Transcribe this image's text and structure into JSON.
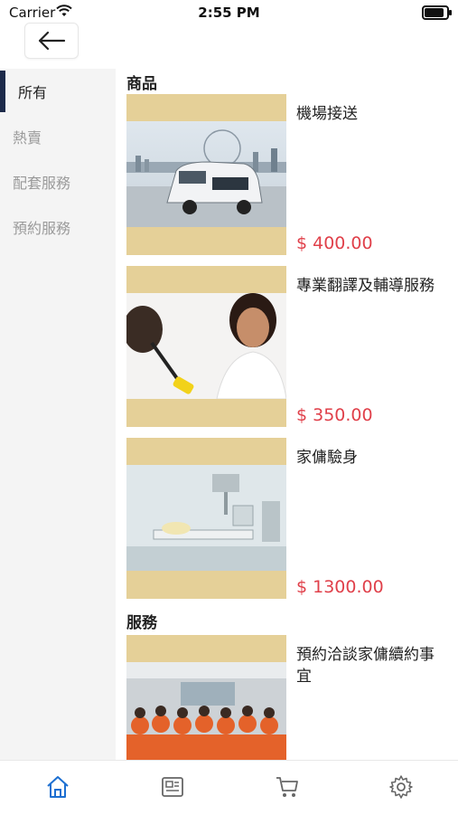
{
  "status_bar": {
    "carrier": "Carrier",
    "time": "2:55 PM"
  },
  "sidebar": {
    "items": [
      {
        "label": "所有",
        "active": true
      },
      {
        "label": "熱賣"
      },
      {
        "label": "配套服務"
      },
      {
        "label": "預約服務"
      }
    ]
  },
  "sections": [
    {
      "title": "商品",
      "items": [
        {
          "name": "機場接送",
          "price": "$ 400.00",
          "image": "minivan-photo"
        },
        {
          "name": "專業翻譯及輔導服務",
          "price": "$ 350.00",
          "image": "woman-duster-photo"
        },
        {
          "name": "家傭驗身",
          "price": "$ 1300.00",
          "image": "xray-room-photo"
        }
      ]
    },
    {
      "title": "服務",
      "items": [
        {
          "name": "預約洽談家傭續約事宜",
          "image": "group-orange-shirts-photo"
        }
      ]
    }
  ],
  "tabbar": {
    "tabs": [
      {
        "icon": "home-icon",
        "active": true
      },
      {
        "icon": "news-icon"
      },
      {
        "icon": "cart-icon"
      },
      {
        "icon": "gear-icon"
      }
    ]
  },
  "colors": {
    "accent": "#1c6fd1",
    "price": "#e0404a",
    "thumb_bg": "#e5d098",
    "sidebar_bg": "#f4f4f4",
    "active_bar": "#1c2a4a"
  }
}
